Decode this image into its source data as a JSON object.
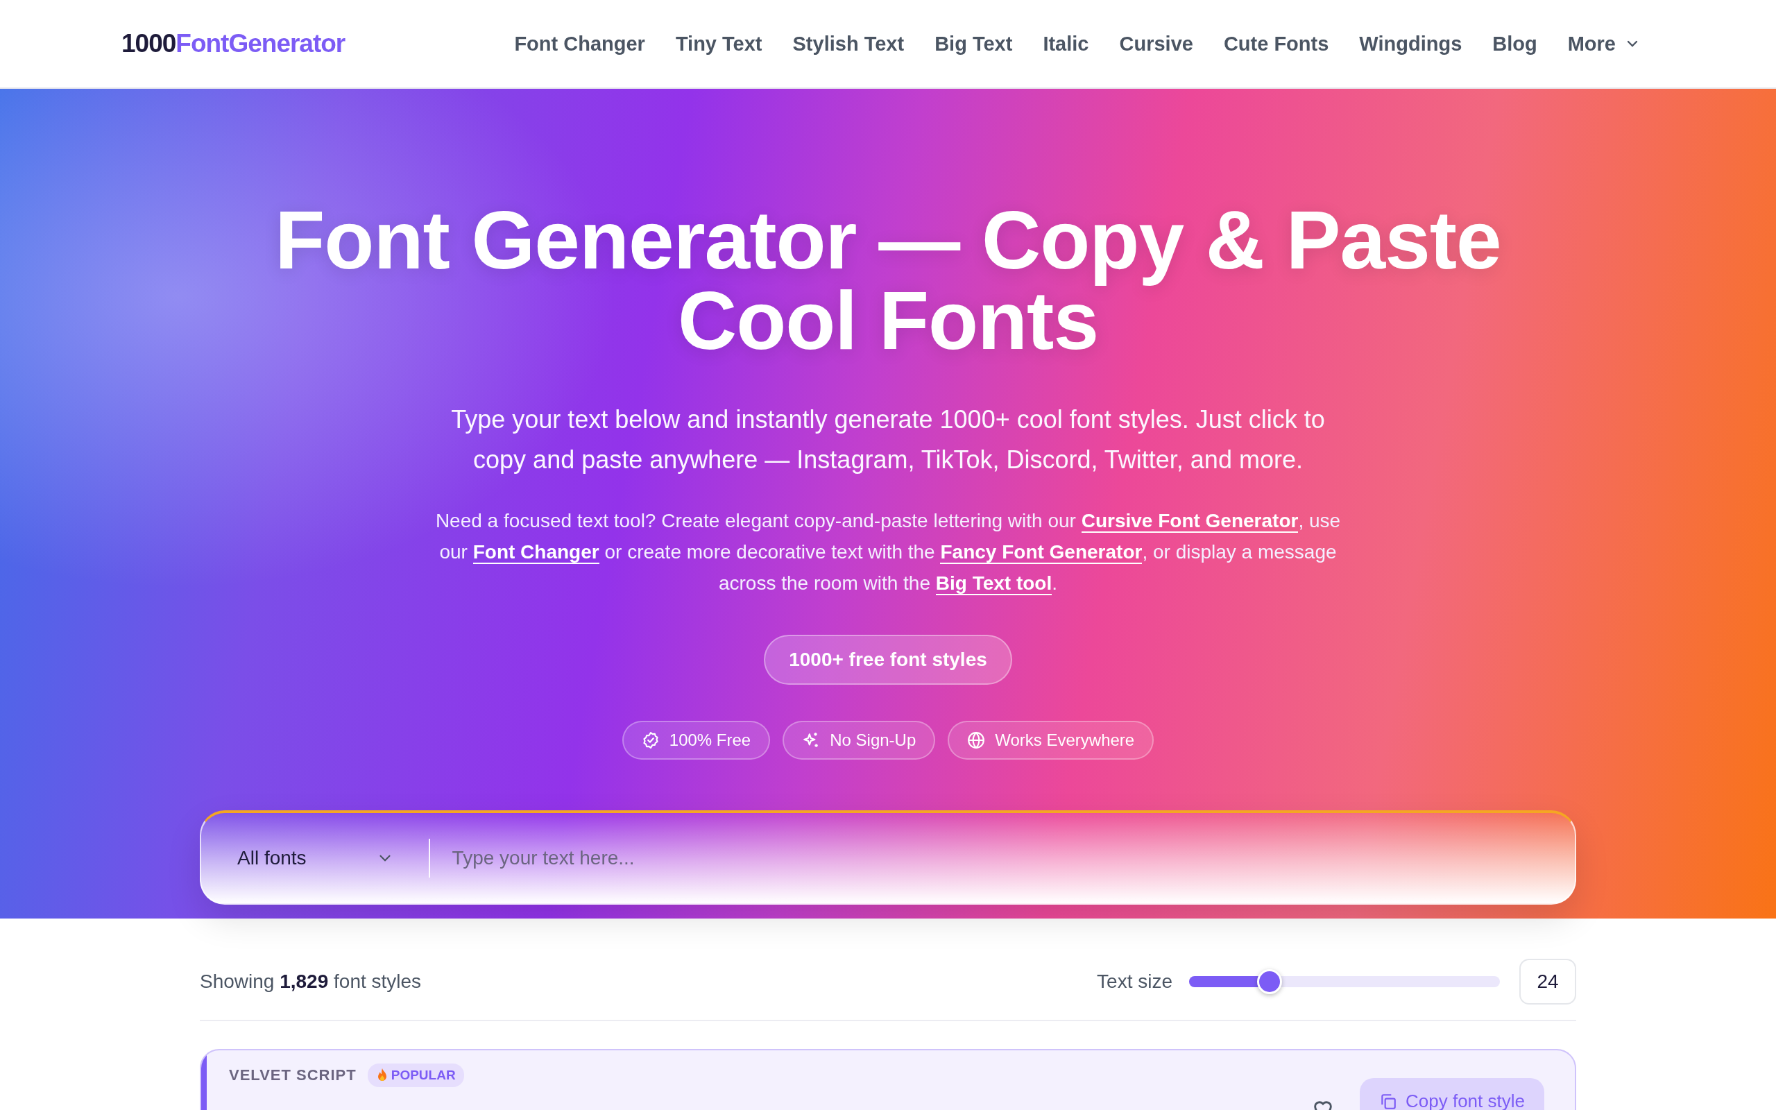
{
  "logo": {
    "prefix": "1000",
    "name": "FontGenerator"
  },
  "nav": [
    {
      "label": "Font Changer"
    },
    {
      "label": "Tiny Text"
    },
    {
      "label": "Stylish Text"
    },
    {
      "label": "Big Text"
    },
    {
      "label": "Italic"
    },
    {
      "label": "Cursive"
    },
    {
      "label": "Cute Fonts"
    },
    {
      "label": "Wingdings"
    },
    {
      "label": "Blog"
    },
    {
      "label": "More",
      "kind": "dropdown"
    }
  ],
  "hero": {
    "title": "Font Generator — Copy & Paste Cool Fonts",
    "subtitle": "Type your text below and instantly generate 1000+ cool font styles. Just click to copy and paste anywhere — Instagram, TikTok, Discord, Twitter, and more.",
    "intro": [
      {
        "kind": "text",
        "text": "Need a focused text tool? Create elegant copy-and-paste lettering with our "
      },
      {
        "kind": "link",
        "text": "Cursive Font Generator"
      },
      {
        "kind": "text",
        "text": ", use our "
      },
      {
        "kind": "link",
        "text": "Font Changer"
      },
      {
        "kind": "text",
        "text": " or create more decorative text with the "
      },
      {
        "kind": "link",
        "text": "Fancy Font Generator"
      },
      {
        "kind": "text",
        "text": ", or display a message across the room with the "
      },
      {
        "kind": "link",
        "text": "Big Text tool"
      },
      {
        "kind": "text",
        "text": "."
      }
    ],
    "cta": "1000+ free font styles",
    "features": [
      {
        "kind": "check",
        "label": "100% Free"
      },
      {
        "kind": "sparkle",
        "label": "No Sign-Up"
      },
      {
        "kind": "globe",
        "label": "Works Everywhere"
      }
    ]
  },
  "search": {
    "category": "All fonts",
    "placeholder": "Type your text here..."
  },
  "results": {
    "prefix": "Showing ",
    "count": "1,829",
    "suffix": " font styles"
  },
  "text_size": {
    "label": "Text size",
    "level": 0.26,
    "value": "24"
  },
  "cards": [
    {
      "name": "VELVET SCRIPT",
      "badge": "POPULAR",
      "copy": "Copy font style"
    }
  ]
}
